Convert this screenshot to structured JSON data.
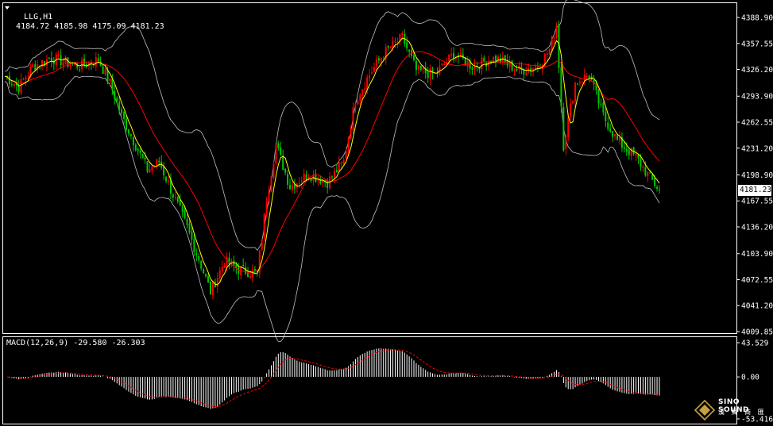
{
  "header": {
    "symbol_label": "LLG,H1",
    "ohlc": "4184.72 4185.98 4175.09 4181.23"
  },
  "macd_panel": {
    "label": "MACD(12,26,9) -29.580 -26.303"
  },
  "current_price": "4181.23",
  "watermark": {
    "brand": "SINO SOUND",
    "sub": "漢 聲 商 匯"
  },
  "colors": {
    "background": "#000000",
    "bull": "#ff0000",
    "bear": "#00c800",
    "grid_border": "#ffffff",
    "bands": "#c0c0c0",
    "ma_fast": "#ffff00",
    "ma_slow": "#ff0000",
    "macd_hist": "#ffffff",
    "macd_signal": "#ff0000"
  },
  "chart_data": [
    {
      "type": "candlestick",
      "title": "LLG,H1",
      "y_ticks": [
        "4388.90",
        "4357.55",
        "4326.20",
        "4293.90",
        "4262.55",
        "4231.20",
        "4198.90",
        "4167.55",
        "4136.20",
        "4103.90",
        "4072.55",
        "4041.20",
        "4009.85"
      ],
      "ylim": [
        4009.85,
        4388.9
      ],
      "indicators": [
        "Bollinger Bands",
        "Moving Average (fast)",
        "Moving Average (slow)"
      ],
      "close_path": [
        {
          "t": 0,
          "v": 4318
        },
        {
          "t": 6,
          "v": 4305
        },
        {
          "t": 12,
          "v": 4330
        },
        {
          "t": 20,
          "v": 4340
        },
        {
          "t": 32,
          "v": 4330
        },
        {
          "t": 40,
          "v": 4338
        },
        {
          "t": 45,
          "v": 4310
        },
        {
          "t": 50,
          "v": 4270
        },
        {
          "t": 56,
          "v": 4235
        },
        {
          "t": 61,
          "v": 4205
        },
        {
          "t": 66,
          "v": 4215
        },
        {
          "t": 72,
          "v": 4175
        },
        {
          "t": 78,
          "v": 4135
        },
        {
          "t": 84,
          "v": 4090
        },
        {
          "t": 88,
          "v": 4058
        },
        {
          "t": 94,
          "v": 4095
        },
        {
          "t": 100,
          "v": 4085
        },
        {
          "t": 108,
          "v": 4080
        },
        {
          "t": 112,
          "v": 4170
        },
        {
          "t": 116,
          "v": 4235
        },
        {
          "t": 122,
          "v": 4185
        },
        {
          "t": 130,
          "v": 4200
        },
        {
          "t": 138,
          "v": 4190
        },
        {
          "t": 145,
          "v": 4215
        },
        {
          "t": 150,
          "v": 4290
        },
        {
          "t": 156,
          "v": 4320
        },
        {
          "t": 162,
          "v": 4345
        },
        {
          "t": 170,
          "v": 4365
        },
        {
          "t": 176,
          "v": 4325
        },
        {
          "t": 184,
          "v": 4320
        },
        {
          "t": 192,
          "v": 4345
        },
        {
          "t": 200,
          "v": 4330
        },
        {
          "t": 210,
          "v": 4340
        },
        {
          "t": 220,
          "v": 4325
        },
        {
          "t": 228,
          "v": 4330
        },
        {
          "t": 233,
          "v": 4350
        },
        {
          "t": 236,
          "v": 4380
        },
        {
          "t": 239,
          "v": 4235
        },
        {
          "t": 244,
          "v": 4310
        },
        {
          "t": 250,
          "v": 4320
        },
        {
          "t": 256,
          "v": 4270
        },
        {
          "t": 262,
          "v": 4240
        },
        {
          "t": 270,
          "v": 4220
        },
        {
          "t": 276,
          "v": 4195
        },
        {
          "t": 280,
          "v": 4181
        }
      ]
    },
    {
      "type": "bar",
      "title": "MACD(12,26,9)",
      "values_label": "-29.580 -26.303",
      "y_ticks": [
        "43.529",
        "0.00",
        "-53.416"
      ],
      "ylim": [
        -53.416,
        43.529
      ]
    }
  ]
}
